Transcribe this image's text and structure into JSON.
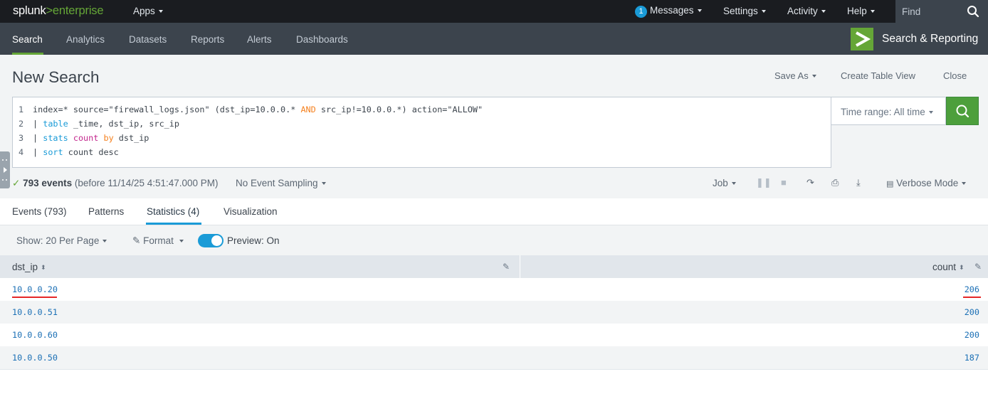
{
  "topbar": {
    "logo_part1": "splunk",
    "logo_part2": ">enterprise",
    "apps_label": "Apps",
    "messages_count": "1",
    "messages_label": "Messages",
    "settings_label": "Settings",
    "activity_label": "Activity",
    "help_label": "Help",
    "find_placeholder": "Find"
  },
  "appbar": {
    "tabs": [
      {
        "label": "Search",
        "active": true
      },
      {
        "label": "Analytics",
        "active": false
      },
      {
        "label": "Datasets",
        "active": false
      },
      {
        "label": "Reports",
        "active": false
      },
      {
        "label": "Alerts",
        "active": false
      },
      {
        "label": "Dashboards",
        "active": false
      }
    ],
    "app_name": "Search & Reporting"
  },
  "search": {
    "title": "New Search",
    "save_as": "Save As",
    "create_table_view": "Create Table View",
    "close": "Close",
    "time_range": "Time range: All time",
    "query_lines": [
      "index=* source=\"firewall_logs.json\" (dst_ip=10.0.0.* AND src_ip!=10.0.0.*) action=\"ALLOW\"",
      "| table _time, dst_ip, src_ip",
      "| stats count by dst_ip",
      "| sort count desc"
    ]
  },
  "status": {
    "event_count": "793 events",
    "before": "(before 11/14/25 4:51:47.000 PM)",
    "sampling": "No Event Sampling",
    "job": "Job",
    "mode": "Verbose Mode"
  },
  "result_tabs": [
    {
      "label": "Events (793)",
      "active": false
    },
    {
      "label": "Patterns",
      "active": false
    },
    {
      "label": "Statistics (4)",
      "active": true
    },
    {
      "label": "Visualization",
      "active": false
    }
  ],
  "options": {
    "per_page": "Show: 20 Per Page",
    "format": "Format",
    "preview": "Preview: On"
  },
  "table": {
    "columns": [
      "dst_ip",
      "count"
    ],
    "rows": [
      {
        "dst_ip": "10.0.0.20",
        "count": "206"
      },
      {
        "dst_ip": "10.0.0.51",
        "count": "200"
      },
      {
        "dst_ip": "10.0.0.60",
        "count": "200"
      },
      {
        "dst_ip": "10.0.0.50",
        "count": "187"
      }
    ]
  },
  "colors": {
    "accent_green": "#65a637",
    "link_blue": "#1a6fb5",
    "annotation_red": "#e52727"
  }
}
